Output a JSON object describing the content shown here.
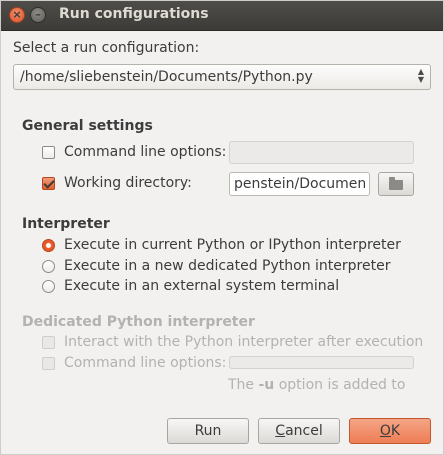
{
  "window": {
    "title": "Run configurations",
    "close_glyph": "×",
    "minimize_glyph": "–"
  },
  "select": {
    "label": "Select a run configuration:",
    "value": "/home/sliebenstein/Documents/Python.py"
  },
  "general": {
    "heading": "General settings",
    "cmd_options_label": "Command line options:",
    "cmd_options_value": "",
    "working_dir_label": "Working directory:",
    "working_dir_value": "penstein/Documents",
    "browse_icon": "folder-icon"
  },
  "interpreter": {
    "heading": "Interpreter",
    "options": [
      "Execute in current Python or IPython interpreter",
      "Execute in a new dedicated Python interpreter",
      "Execute in an external system terminal"
    ],
    "selected_index": 0
  },
  "dedicated": {
    "heading": "Dedicated Python interpreter",
    "interact_label": "Interact with the Python interpreter after execution",
    "cmd_options_label": "Command line options:",
    "cmd_options_value": "",
    "note_prefix": "The ",
    "note_flag": "-u",
    "note_suffix": " option is added to"
  },
  "buttons": {
    "run": "Run",
    "cancel_underlined": "C",
    "cancel_rest": "ancel",
    "ok_underlined": "O",
    "ok_rest": "K"
  },
  "colors": {
    "accent": "#e8592a",
    "titlebar": "#3c3b37",
    "background": "#f2f1f0"
  }
}
